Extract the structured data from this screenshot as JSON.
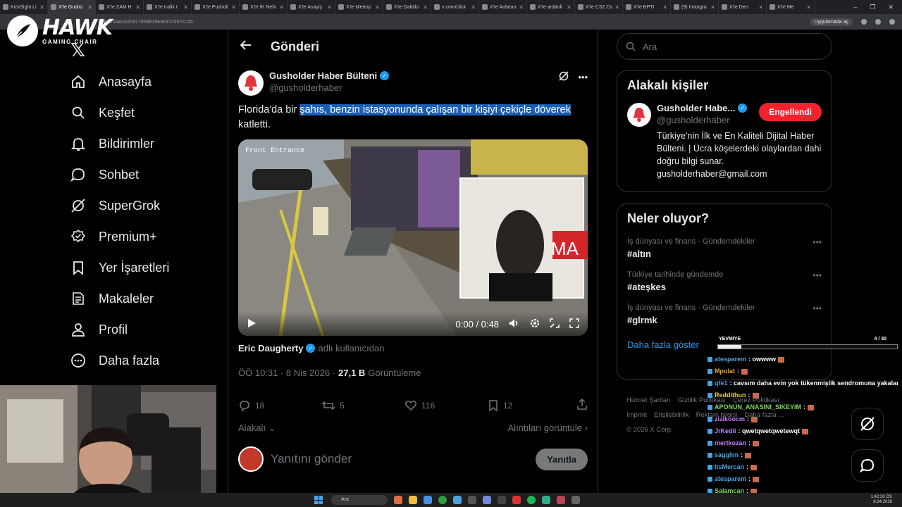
{
  "browser": {
    "tabs": [
      {
        "label": "KickSight Li",
        "active": false
      },
      {
        "label": "X'te Gusho",
        "active": true
      },
      {
        "label": "X'te ZAM H",
        "active": false
      },
      {
        "label": "X'te trafik t",
        "active": false
      },
      {
        "label": "X'te Pusholi",
        "active": false
      },
      {
        "label": "X'te İK Nehi",
        "active": false
      },
      {
        "label": "X'te Asayiş",
        "active": false
      },
      {
        "label": "X'te Metrop",
        "active": false
      },
      {
        "label": "X'te Daktilo",
        "active": false
      },
      {
        "label": "x.com/click",
        "active": false
      },
      {
        "label": "X'te Anbean",
        "active": false
      },
      {
        "label": "X'te ardanli",
        "active": false
      },
      {
        "label": "X'te CS2 Co",
        "active": false
      },
      {
        "label": "X'te BPTI",
        "active": false
      },
      {
        "label": "(9) Instagra",
        "active": false
      },
      {
        "label": "X'te Den",
        "active": false
      },
      {
        "label": "X'te Me",
        "active": false
      }
    ],
    "url": "haber/status/2041780981963637236?s=20",
    "app_install": "Uygulamada aç"
  },
  "overlay_logo": {
    "title": "HAWK",
    "subtitle": "GAMING CHAIR"
  },
  "nav": {
    "x_logo": "𝕏",
    "items": [
      {
        "label": "Anasayfa",
        "icon": "home-icon"
      },
      {
        "label": "Keşfet",
        "icon": "search-icon"
      },
      {
        "label": "Bildirimler",
        "icon": "bell-icon"
      },
      {
        "label": "Sohbet",
        "icon": "chat-icon"
      },
      {
        "label": "SuperGrok",
        "icon": "grok-icon"
      },
      {
        "label": "Premium+",
        "icon": "premium-icon"
      },
      {
        "label": "Yer İşaretleri",
        "icon": "bookmark-icon"
      },
      {
        "label": "Makaleler",
        "icon": "article-icon"
      },
      {
        "label": "Profil",
        "icon": "profile-icon"
      },
      {
        "label": "Daha fazla",
        "icon": "more-icon"
      }
    ]
  },
  "main": {
    "title": "Gönderi",
    "author": {
      "name": "Gusholder Haber Bülteni",
      "handle": "@gusholderhaber"
    },
    "text_before": "Florida'da bir ",
    "text_highlight": "şahıs, benzin istasyonunda çalışan bir kişiyi çekiçle döverek",
    "text_after": " katletti.",
    "video": {
      "time": "0:00 / 0:48",
      "sign": "MA",
      "overlay": "Front Entrance"
    },
    "via": {
      "name": "Eric Daugherty",
      "suffix": "adlı kullanıcıdan"
    },
    "meta": {
      "time": "ÖÖ 10:31 · 8 Nis 2026 · ",
      "views": "27,1 B",
      "views_label": "Görüntüleme"
    },
    "stats": {
      "replies": "18",
      "reposts": "5",
      "likes": "116",
      "bookmarks": "12"
    },
    "relevant": "Alakalı",
    "quotes": "Alıntıları görüntüle",
    "reply_placeholder": "Yanıtını gönder",
    "reply_button": "Yanıtla"
  },
  "search": {
    "placeholder": "Ara"
  },
  "people": {
    "title": "Alakalı kişiler",
    "name": "Gusholder Habe...",
    "handle": "@gusholderhaber",
    "button": "Engellendi",
    "bio": "Türkiye'nin İlk ve En Kaliteli Dijital Haber Bülteni. | Ücra köşelerdeki olaylardan dahi doğru bilgi sunar. gusholderhaber@gmail.com"
  },
  "trends": {
    "title": "Neler oluyor?",
    "items": [
      {
        "category": "İş dünyası ve finans · Gündemdekiler",
        "tag": "#altın"
      },
      {
        "category": "Türkiye tarihinde gündemde",
        "tag": "#ateşkes"
      },
      {
        "category": "İş dünyası ve finans · Gündemdekiler",
        "tag": "#glrmk"
      }
    ],
    "show_more": "Daha fazla göster"
  },
  "footer": {
    "links": [
      "Hizmet Şartları",
      "Gizlilik Politikası",
      "Çerez Politikası",
      "Imprint",
      "Erişilebilirlik",
      "Reklam bilgisi",
      "Daha fazla ..."
    ],
    "copyright": "© 2026 X Corp."
  },
  "chat": {
    "header": "YEVMİYE",
    "count": "4 / 30",
    "progress": 0.13,
    "lines": [
      {
        "user": "atesparem",
        "color": "#4aa3df",
        "msg": ": owwww"
      },
      {
        "user": "Mpolat",
        "color": "#e9a23b",
        "msg": ":"
      },
      {
        "user": "qfe1",
        "color": "#4aa3df",
        "msg": ": cavsım daha evin yok tükenmişlik sendromuna yakalanma"
      },
      {
        "user": "Reddithun",
        "color": "#e9d23b",
        "msg": ":"
      },
      {
        "user": "APONUN_ANASINI_SIKEYIM",
        "color": "#7ed957",
        "msg": ":"
      },
      {
        "user": "zizikoocm",
        "color": "#c77dff",
        "msg": ":"
      },
      {
        "user": "JrKedii",
        "color": "#b38cff",
        "msg": ": qwetqwetqwetewqt"
      },
      {
        "user": "mertkozan",
        "color": "#c77dff",
        "msg": ":"
      },
      {
        "user": "sagglim",
        "color": "#4aa3df",
        "msg": ":"
      },
      {
        "user": "ItsMercan",
        "color": "#4aa3df",
        "msg": ":"
      },
      {
        "user": "atesparem",
        "color": "#4aa3df",
        "msg": ":"
      },
      {
        "user": "Salamcan",
        "color": "#7ed957",
        "msg": ":"
      }
    ]
  },
  "taskbar": {
    "search": "Ara",
    "time": "1:42:20 ÖS",
    "date": "8.04.2026"
  }
}
